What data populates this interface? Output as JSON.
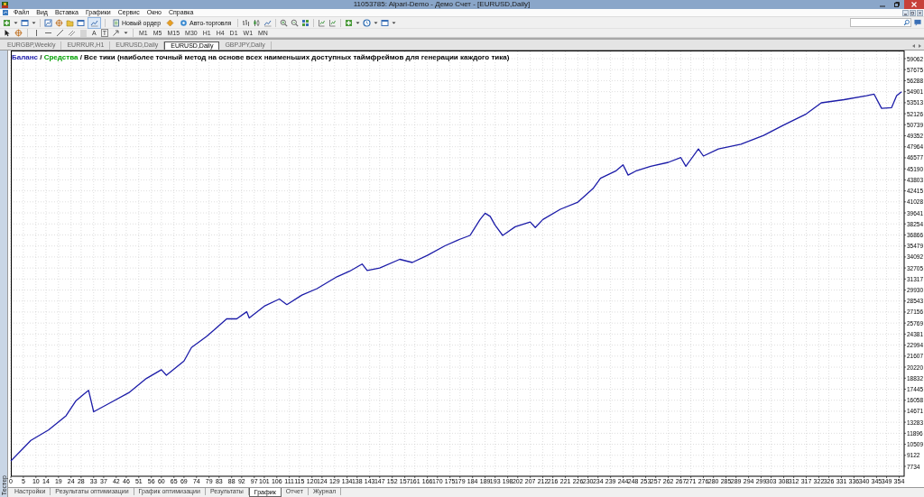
{
  "window": {
    "title": "11053785: Alpari-Demo - Демо Счет - [EURUSD,Daily]"
  },
  "menu": [
    "Файл",
    "Вид",
    "Вставка",
    "Графики",
    "Сервис",
    "Окно",
    "Справка"
  ],
  "toolbar": {
    "new_order": "Новый ордер",
    "autotrading": "Авто-торговля",
    "text_tools": [
      "A",
      "T"
    ],
    "timeframes": [
      "M1",
      "M5",
      "M15",
      "M30",
      "H1",
      "H4",
      "D1",
      "W1",
      "MN"
    ]
  },
  "chart_tabs": [
    {
      "label": "EURGBP,Weekly",
      "selected": false
    },
    {
      "label": "EURRUR,H1",
      "selected": false
    },
    {
      "label": "EURUSD,Daily",
      "selected": false
    },
    {
      "label": "EURUSD,Daily",
      "selected": true
    },
    {
      "label": "GBPJPY,Daily",
      "selected": false
    }
  ],
  "tester": {
    "side_label": "Тестер",
    "legend": [
      {
        "prefix": "/",
        "text": "Средства",
        "color": "#00a000"
      },
      {
        "prefix": "/",
        "text": "Все тики (наиболее точный метод на основе всех наименьших доступных таймфреймов для генерации каждого тика)",
        "color": "#000000"
      }
    ],
    "chart_data": {
      "type": "line",
      "x": [
        0,
        8,
        15,
        22,
        26,
        29,
        31,
        33,
        40,
        47,
        54,
        60,
        62,
        69,
        72,
        78,
        81,
        86,
        90,
        94,
        95,
        101,
        107,
        110,
        116,
        122,
        130,
        135,
        140,
        142,
        147,
        155,
        160,
        166,
        173,
        178,
        183,
        187,
        189,
        191,
        193,
        196,
        201,
        207,
        209,
        212,
        219,
        226,
        232,
        235,
        241,
        244,
        246,
        249,
        255,
        262,
        267,
        269,
        274,
        276,
        282,
        291,
        300,
        308,
        317,
        323,
        332,
        341,
        344,
        347,
        351,
        353,
        355
      ],
      "series": [
        {
          "name": "Баланс",
          "color": "#1c1ca8",
          "values": [
            8400,
            11000,
            12300,
            14100,
            16000,
            16800,
            17300,
            14600,
            15800,
            17000,
            18800,
            19900,
            19200,
            21000,
            22700,
            24100,
            24900,
            26300,
            26300,
            27200,
            26400,
            27900,
            28800,
            28100,
            29300,
            30100,
            31600,
            32300,
            33200,
            32400,
            32700,
            33800,
            33400,
            34300,
            35500,
            36200,
            36800,
            38800,
            39600,
            39200,
            38100,
            36800,
            37900,
            38500,
            37800,
            38800,
            40100,
            41000,
            42700,
            44000,
            44900,
            45700,
            44400,
            44900,
            45500,
            46000,
            46600,
            45500,
            47700,
            46800,
            47700,
            48300,
            49400,
            50700,
            52100,
            53500,
            53900,
            54400,
            54600,
            52800,
            52900,
            54400,
            54900
          ]
        }
      ],
      "grid": true,
      "xlim": [
        0,
        356
      ],
      "ylim": [
        7734,
        59062
      ],
      "xticks": [
        0,
        5,
        10,
        14,
        19,
        24,
        28,
        33,
        37,
        42,
        46,
        51,
        56,
        60,
        65,
        69,
        74,
        79,
        83,
        88,
        92,
        97,
        101,
        106,
        111,
        115,
        120,
        124,
        129,
        134,
        138,
        143,
        147,
        152,
        157,
        161,
        166,
        170,
        175,
        179,
        184,
        189,
        193,
        198,
        202,
        207,
        212,
        216,
        221,
        226,
        230,
        234,
        239,
        244,
        248,
        253,
        257,
        262,
        267,
        271,
        276,
        280,
        285,
        289,
        294,
        299,
        303,
        308,
        312,
        317,
        322,
        326,
        331,
        336,
        340,
        345,
        349,
        354
      ],
      "yticks": [
        7734,
        9122,
        10509,
        11896,
        13283,
        14671,
        16058,
        17445,
        18832,
        20220,
        21607,
        22994,
        24381,
        25769,
        27156,
        28543,
        29930,
        31317,
        32705,
        34092,
        35479,
        36866,
        38254,
        39641,
        41028,
        42415,
        43803,
        45190,
        46577,
        47964,
        49352,
        50739,
        52126,
        53513,
        54901,
        56288,
        57675,
        59062
      ]
    },
    "tabs": [
      {
        "label": "Настройки",
        "selected": false
      },
      {
        "label": "Результаты оптимизации",
        "selected": false
      },
      {
        "label": "График оптимизации",
        "selected": false
      },
      {
        "label": "Результаты",
        "selected": false
      },
      {
        "label": "График",
        "selected": true
      },
      {
        "label": "Отчет",
        "selected": false
      },
      {
        "label": "Журнал",
        "selected": false
      }
    ]
  }
}
